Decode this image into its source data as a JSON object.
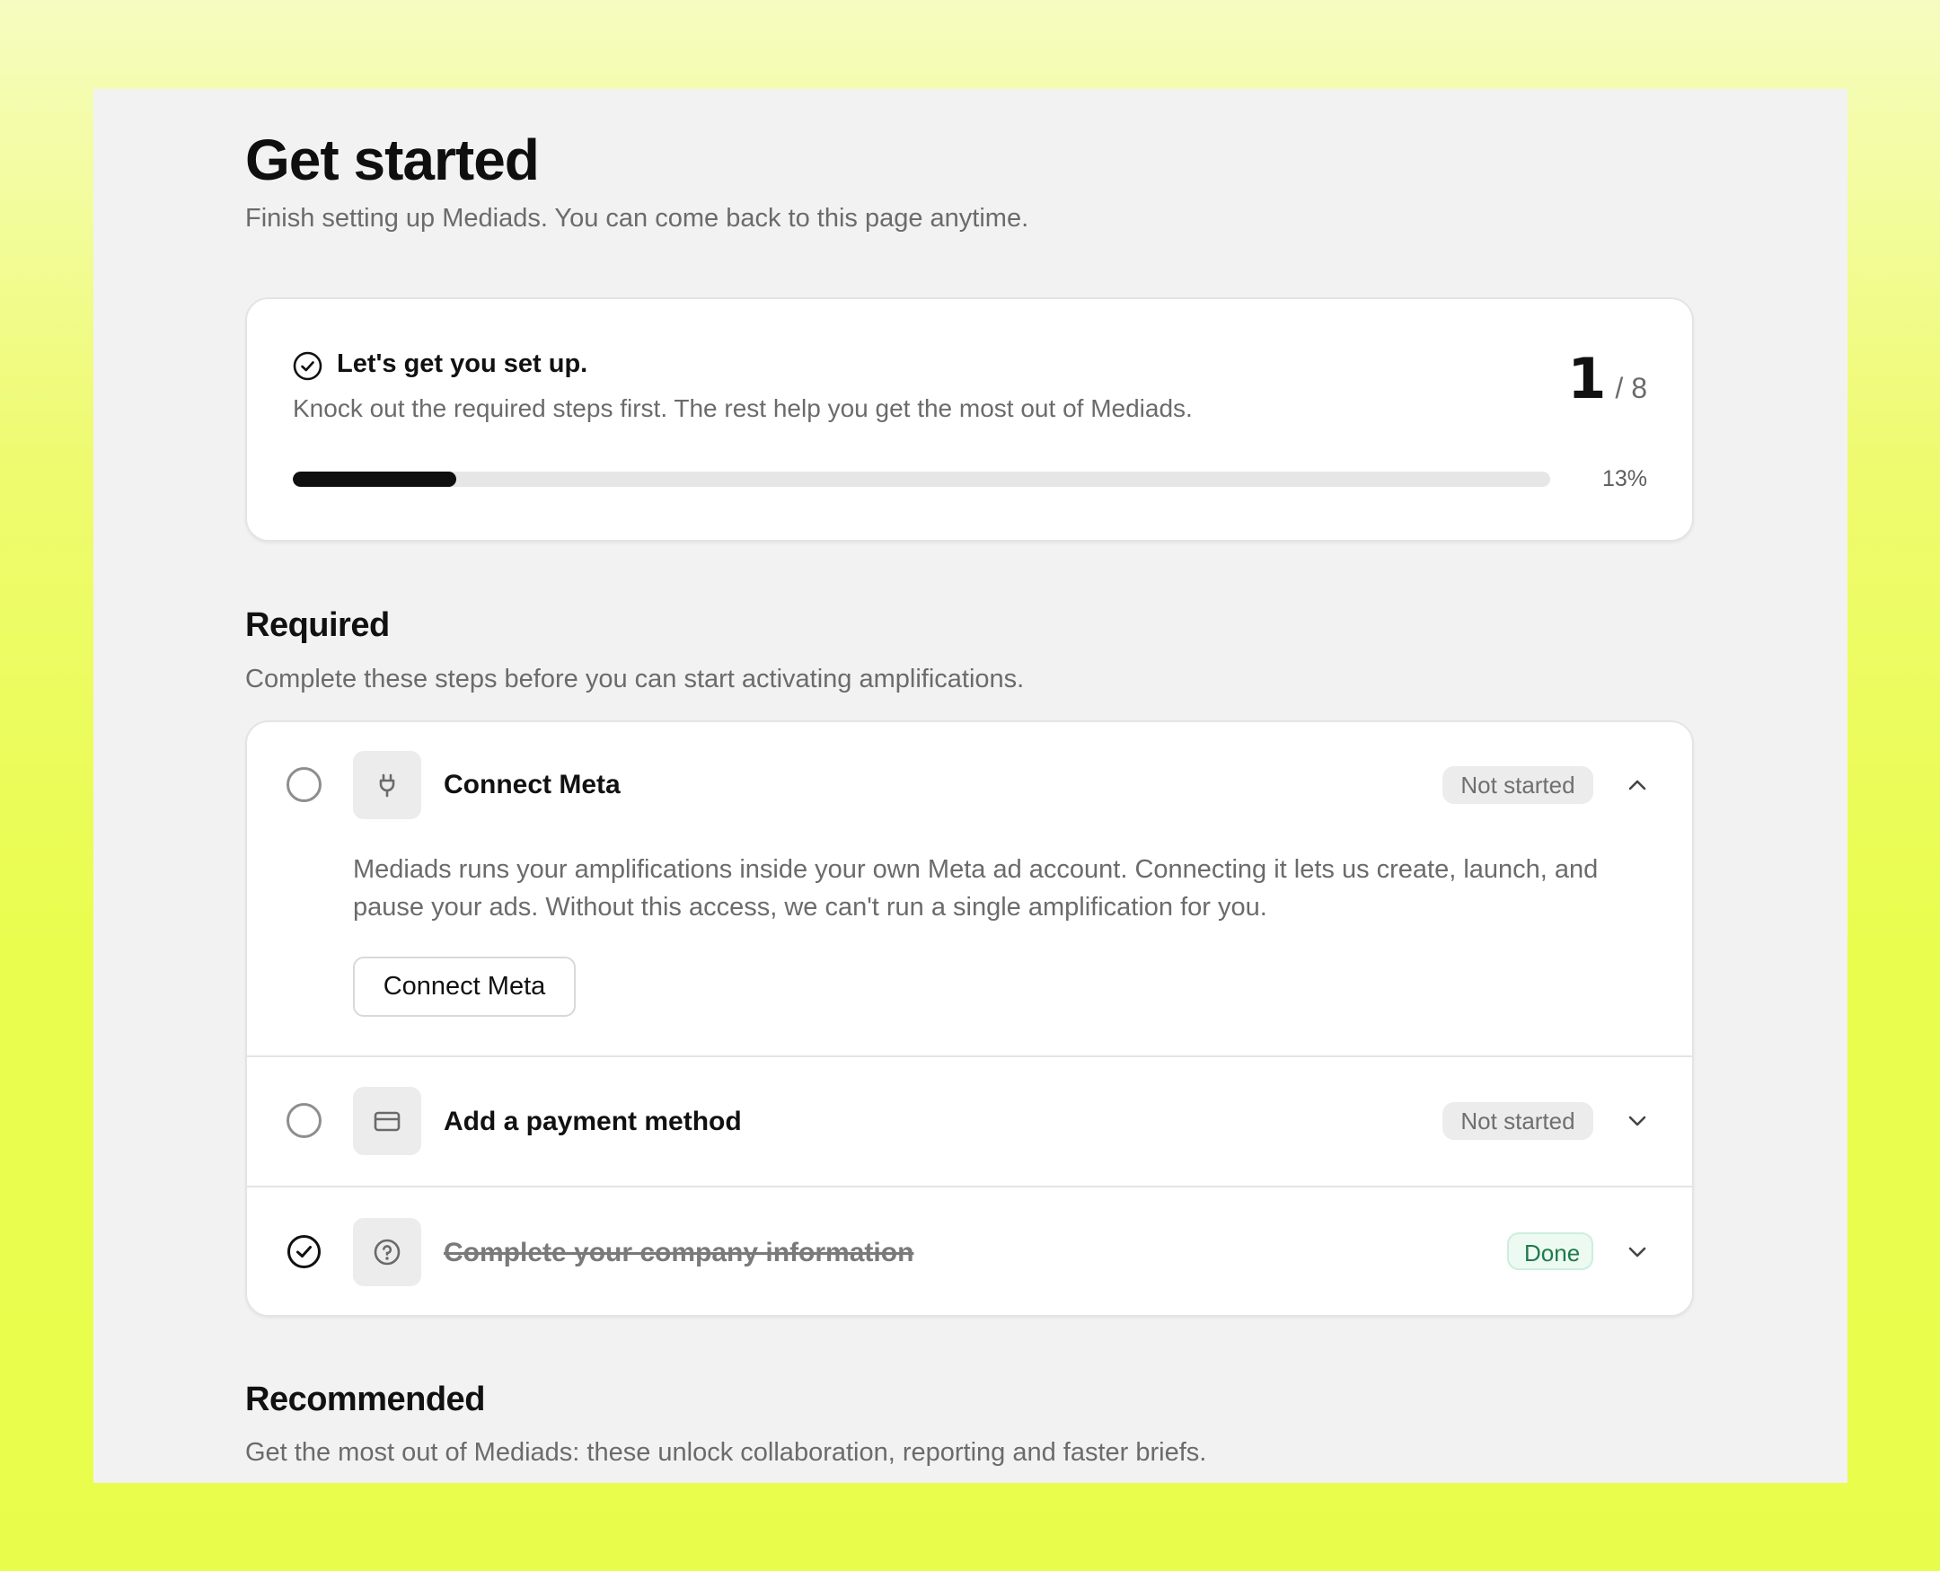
{
  "page": {
    "title": "Get started",
    "subtitle": "Finish setting up Mediads. You can come back to this page anytime."
  },
  "progress": {
    "title": "Let's get you set up.",
    "description": "Knock out the required steps first. The rest help you get the most out of Mediads.",
    "completed": "1",
    "total": "/ 8",
    "percent_label": "13%",
    "percent_value": 0.13
  },
  "required": {
    "title": "Required",
    "description": "Complete these steps before you can start activating amplifications.",
    "steps": [
      {
        "label": "Connect Meta",
        "status": "Not started",
        "icon": "plug-icon",
        "expanded": true,
        "description": "Mediads runs your amplifications inside your own Meta ad account. Connecting it lets us create, launch, and pause your ads. Without this access, we can't run a single amplification for you.",
        "action_label": "Connect Meta"
      },
      {
        "label": "Add a payment method",
        "status": "Not started",
        "icon": "credit-card-icon",
        "expanded": false
      },
      {
        "label": "Complete your company information",
        "status": "Done",
        "icon": "question-circle-icon",
        "expanded": false
      }
    ]
  },
  "recommended": {
    "title": "Recommended",
    "description": "Get the most out of Mediads: these unlock collaboration, reporting and faster briefs."
  },
  "colors": {
    "background_top": "#f6fcc0",
    "background_bottom": "#e8fd4b",
    "panel": "#f2f2f2",
    "done_badge_text": "#1f7a4a",
    "done_badge_bg": "#edfaf2"
  }
}
